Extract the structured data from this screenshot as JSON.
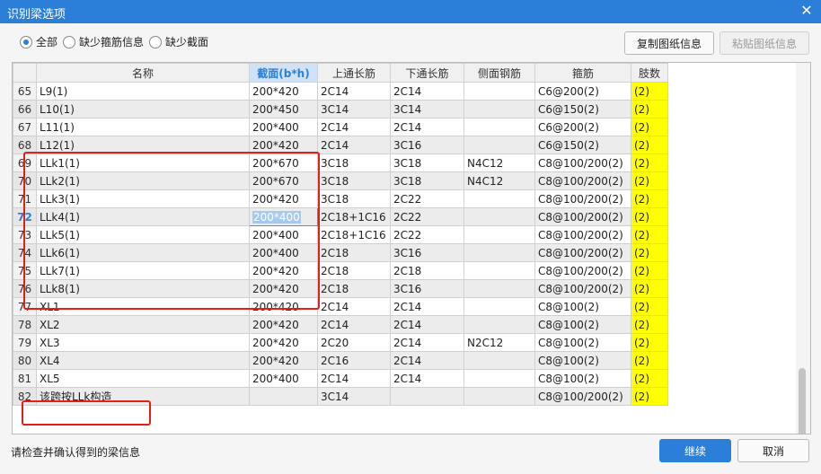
{
  "window": {
    "title": "识别梁选项",
    "close_glyph": "✕"
  },
  "filters": [
    {
      "label": "全部",
      "checked": true
    },
    {
      "label": "缺少箍筋信息",
      "checked": false
    },
    {
      "label": "缺少截面",
      "checked": false
    }
  ],
  "toolbar": {
    "copy_label": "复制图纸信息",
    "paste_label": "粘贴图纸信息"
  },
  "table": {
    "columns": [
      "",
      "名称",
      "截面(b*h)",
      "上通长筋",
      "下通长筋",
      "侧面钢筋",
      "箍筋",
      "肢数"
    ],
    "selected_column": 2,
    "current_row": 72,
    "rows": [
      {
        "num": "65",
        "name": "L9(1)",
        "section": "200*420",
        "top": "2C14",
        "bottom": "2C14",
        "side": "",
        "stirrup": "C6@200(2)",
        "legs": "(2)"
      },
      {
        "num": "66",
        "name": "L10(1)",
        "section": "200*450",
        "top": "3C14",
        "bottom": "3C14",
        "side": "",
        "stirrup": "C6@150(2)",
        "legs": "(2)"
      },
      {
        "num": "67",
        "name": "L11(1)",
        "section": "200*400",
        "top": "2C14",
        "bottom": "2C14",
        "side": "",
        "stirrup": "C6@200(2)",
        "legs": "(2)"
      },
      {
        "num": "68",
        "name": "L12(1)",
        "section": "200*420",
        "top": "2C14",
        "bottom": "3C16",
        "side": "",
        "stirrup": "C6@150(2)",
        "legs": "(2)"
      },
      {
        "num": "69",
        "name": "LLk1(1)",
        "section": "200*670",
        "top": "3C18",
        "bottom": "3C18",
        "side": "N4C12",
        "stirrup": "C8@100/200(2)",
        "legs": "(2)"
      },
      {
        "num": "70",
        "name": "LLk2(1)",
        "section": "200*670",
        "top": "3C18",
        "bottom": "3C18",
        "side": "N4C12",
        "stirrup": "C8@100/200(2)",
        "legs": "(2)"
      },
      {
        "num": "71",
        "name": "LLk3(1)",
        "section": "200*420",
        "top": "3C18",
        "bottom": "2C22",
        "side": "",
        "stirrup": "C8@100/200(2)",
        "legs": "(2)"
      },
      {
        "num": "72",
        "name": "LLk4(1)",
        "section": "200*400",
        "top": "2C18+1C16",
        "bottom": "2C22",
        "side": "",
        "stirrup": "C8@100/200(2)",
        "legs": "(2)"
      },
      {
        "num": "73",
        "name": "LLk5(1)",
        "section": "200*400",
        "top": "2C18+1C16",
        "bottom": "2C22",
        "side": "",
        "stirrup": "C8@100/200(2)",
        "legs": "(2)"
      },
      {
        "num": "74",
        "name": "LLk6(1)",
        "section": "200*400",
        "top": "2C18",
        "bottom": "3C16",
        "side": "",
        "stirrup": "C8@100/200(2)",
        "legs": "(2)"
      },
      {
        "num": "75",
        "name": "LLk7(1)",
        "section": "200*420",
        "top": "2C18",
        "bottom": "2C18",
        "side": "",
        "stirrup": "C8@100/200(2)",
        "legs": "(2)"
      },
      {
        "num": "76",
        "name": "LLk8(1)",
        "section": "200*420",
        "top": "2C18",
        "bottom": "3C16",
        "side": "",
        "stirrup": "C8@100/200(2)",
        "legs": "(2)"
      },
      {
        "num": "77",
        "name": "XL1",
        "section": "200*420",
        "top": "2C14",
        "bottom": "2C14",
        "side": "",
        "stirrup": "C8@100(2)",
        "legs": "(2)"
      },
      {
        "num": "78",
        "name": "XL2",
        "section": "200*420",
        "top": "2C14",
        "bottom": "2C14",
        "side": "",
        "stirrup": "C8@100(2)",
        "legs": "(2)"
      },
      {
        "num": "79",
        "name": "XL3",
        "section": "200*420",
        "top": "2C20",
        "bottom": "2C14",
        "side": "N2C12",
        "stirrup": "C8@100(2)",
        "legs": "(2)"
      },
      {
        "num": "80",
        "name": "XL4",
        "section": "200*420",
        "top": "2C16",
        "bottom": "2C14",
        "side": "",
        "stirrup": "C8@100(2)",
        "legs": "(2)"
      },
      {
        "num": "81",
        "name": "XL5",
        "section": "200*400",
        "top": "2C14",
        "bottom": "2C14",
        "side": "",
        "stirrup": "C8@100(2)",
        "legs": "(2)"
      },
      {
        "num": "82",
        "name": "该跨按LLk构造",
        "section": "",
        "top": "3C14",
        "bottom": "",
        "side": "",
        "stirrup": "C8@100/200(2)",
        "legs": "(2)"
      }
    ]
  },
  "status_text": "请检查并确认得到的梁信息",
  "footer": {
    "ok_label": "继续",
    "cancel_label": "取消"
  },
  "colors": {
    "accent": "#2b7fd8",
    "highlight": "#ffff00",
    "annotation": "#e0201a"
  }
}
